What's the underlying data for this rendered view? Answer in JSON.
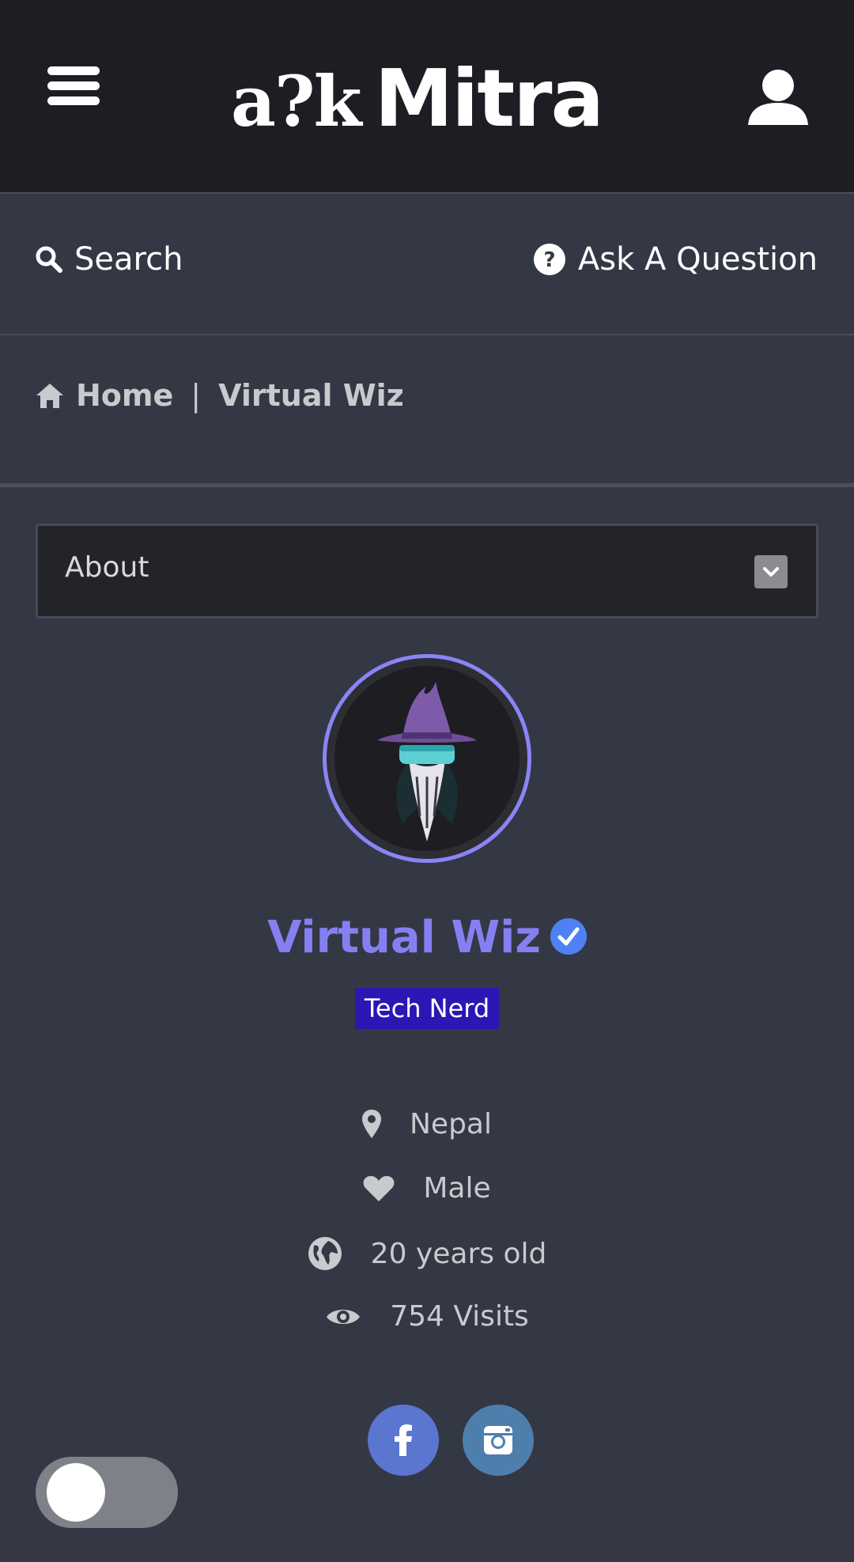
{
  "header": {
    "logo_prefix": "a?k",
    "logo_word": "Mitra",
    "menu_icon": "hamburger-icon",
    "user_icon": "user-icon"
  },
  "actions": {
    "search_label": "Search",
    "ask_label": "Ask A Question"
  },
  "breadcrumb": {
    "home_label": "Home",
    "separator": "|",
    "current": "Virtual Wiz"
  },
  "about_select": {
    "selected": "About"
  },
  "profile": {
    "name": "Virtual Wiz",
    "verified": true,
    "badge": "Tech Nerd",
    "badge_color": "#2c16b4",
    "name_color": "#8580f2"
  },
  "details": {
    "location": "Nepal",
    "gender": "Male",
    "age": "20 years old",
    "visits": "754 Visits"
  },
  "social": {
    "facebook_color": "#5b76cf",
    "instagram_color": "#4e7fac"
  },
  "theme_toggle": {
    "state": "off"
  }
}
